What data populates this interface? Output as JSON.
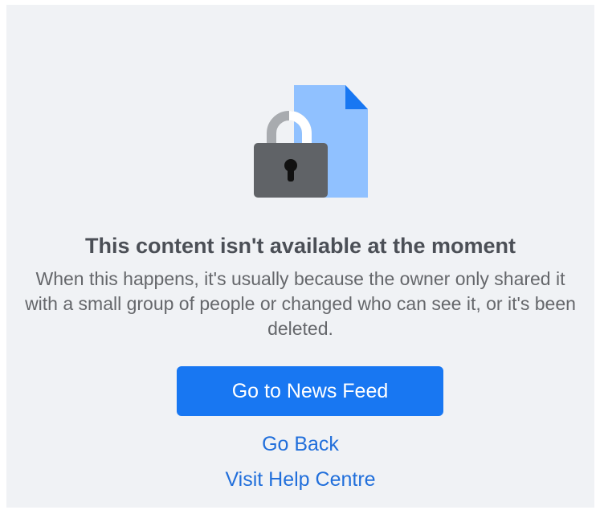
{
  "error": {
    "title": "This content isn't available at the moment",
    "message": "When this happens, it's usually because the owner only shared it with a small group of people or changed who can see it, or it's been deleted."
  },
  "actions": {
    "primary_label": "Go to News Feed",
    "back_label": "Go Back",
    "help_label": "Visit Help Centre"
  },
  "icons": {
    "illustration": "locked-document-icon"
  },
  "colors": {
    "primary_button": "#1877f2",
    "link": "#216fdb",
    "background": "#f0f2f5"
  }
}
